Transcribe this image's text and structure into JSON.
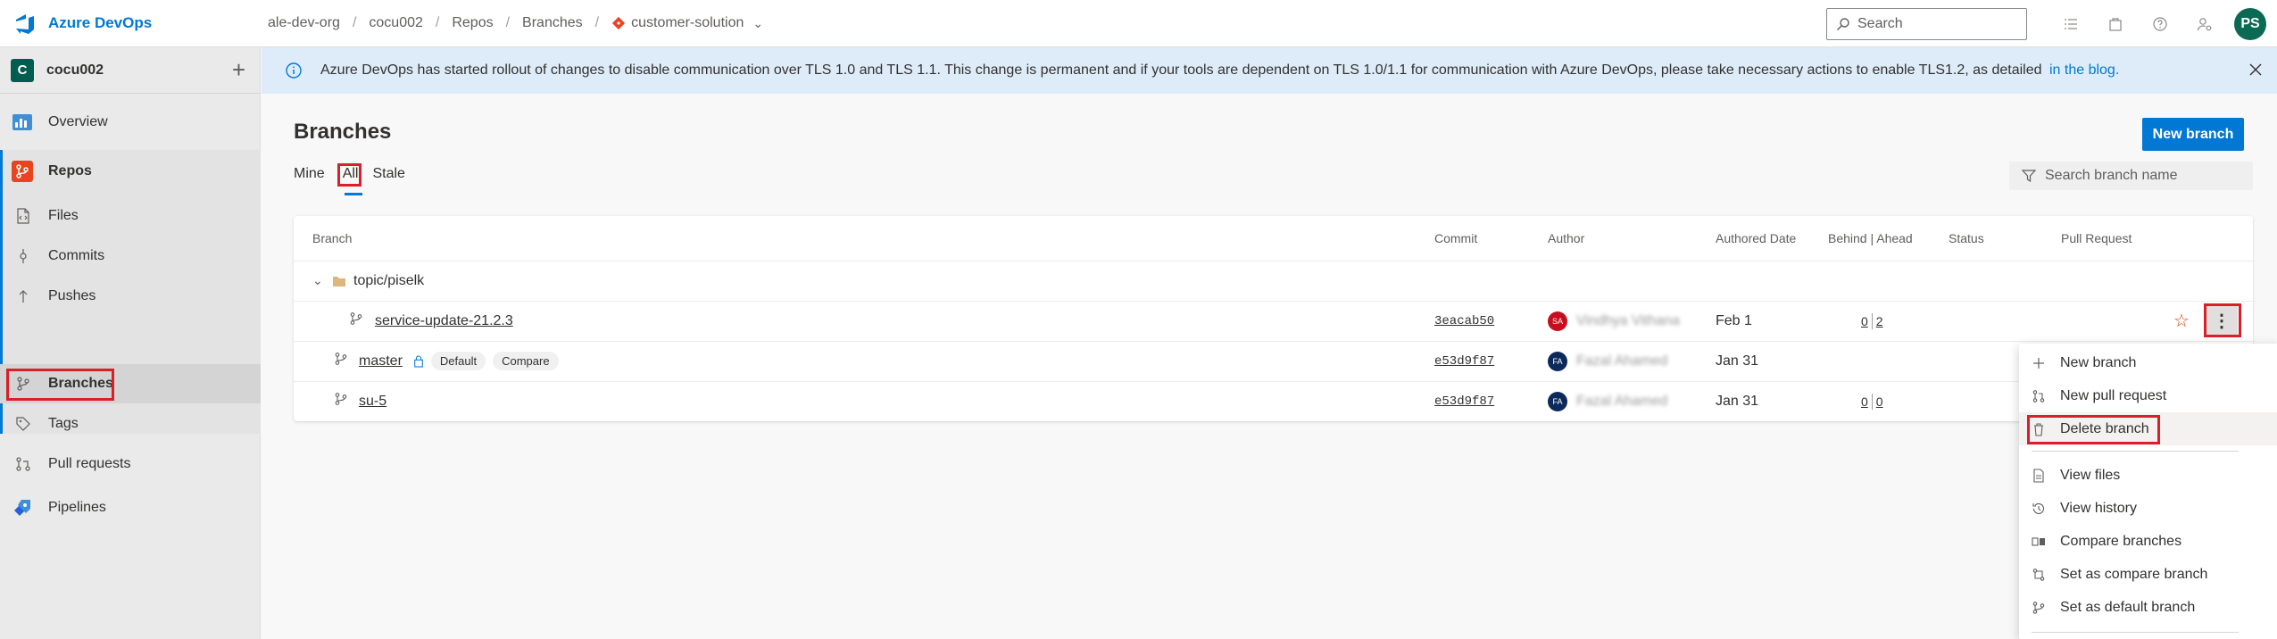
{
  "header": {
    "brand": "Azure DevOps",
    "breadcrumb": [
      "ale-dev-org",
      "cocu002",
      "Repos",
      "Branches",
      "customer-solution"
    ],
    "search_placeholder": "Search",
    "user_initials": "PS"
  },
  "sidebar": {
    "project_initial": "C",
    "project_name": "cocu002",
    "items": [
      {
        "label": "Overview",
        "icon": "overview-icon"
      },
      {
        "label": "Repos",
        "icon": "repos-icon"
      },
      {
        "label": "Files",
        "icon": "file-icon"
      },
      {
        "label": "Commits",
        "icon": "commit-icon"
      },
      {
        "label": "Pushes",
        "icon": "push-icon"
      },
      {
        "label": "Branches",
        "icon": "branch-icon"
      },
      {
        "label": "Tags",
        "icon": "tag-icon"
      },
      {
        "label": "Pull requests",
        "icon": "pull-request-icon"
      },
      {
        "label": "Pipelines",
        "icon": "pipelines-icon"
      }
    ]
  },
  "banner": {
    "text": "Azure DevOps has started rollout of changes to disable communication over TLS 1.0 and TLS 1.1. This change is permanent and if your tools are dependent on TLS 1.0/1.1 for communication with Azure DevOps, please take necessary actions to enable TLS1.2, as detailed",
    "link": "in the blog."
  },
  "main": {
    "title": "Branches",
    "new_branch_label": "New branch",
    "pivots": [
      "Mine",
      "All",
      "Stale"
    ],
    "filter_placeholder": "Search branch name",
    "columns": [
      "Branch",
      "Commit",
      "Author",
      "Authored Date",
      "Behind | Ahead",
      "Status",
      "Pull Request"
    ],
    "folder": "topic/piselk",
    "rows": [
      {
        "branch": "service-update-21.2.3",
        "commit": "3eacab50",
        "author_initials": "SA",
        "author": "Vindhya Vithana",
        "date": "Feb 1",
        "behind": "0",
        "ahead": "2",
        "tags": [],
        "avatar_color": "#c50f1f"
      },
      {
        "branch": "master",
        "commit": "e53d9f87",
        "author_initials": "FA",
        "author": "Fazal Ahamed",
        "date": "Jan 31",
        "behind": "",
        "ahead": "",
        "tags": [
          "Default",
          "Compare"
        ],
        "avatar_color": "#0b2a5b"
      },
      {
        "branch": "su-5",
        "commit": "e53d9f87",
        "author_initials": "FA",
        "author": "Fazal Ahamed",
        "date": "Jan 31",
        "behind": "0",
        "ahead": "0",
        "tags": [],
        "avatar_color": "#0b2a5b"
      }
    ]
  },
  "menu": {
    "items": [
      "New branch",
      "New pull request",
      "Delete branch",
      "View files",
      "View history",
      "Compare branches",
      "Set as compare branch",
      "Set as default branch"
    ]
  },
  "colors": {
    "accent": "#0078d4",
    "highlight": "#d9202a"
  }
}
